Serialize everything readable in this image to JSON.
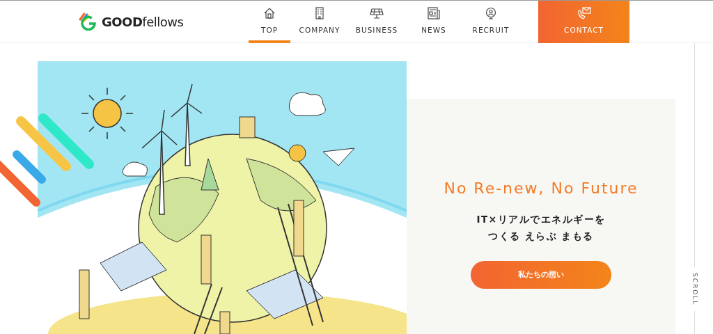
{
  "logo": {
    "text": "**GOOD**fellows"
  },
  "nav": [
    {
      "label": "TOP",
      "selected": true
    },
    {
      "label": "COMPANY",
      "selected": false
    },
    {
      "label": "BUSINESS",
      "selected": false
    },
    {
      "label": "NEWS",
      "selected": false
    },
    {
      "label": "RECRUIT",
      "selected": false
    }
  ],
  "contact": {
    "label": "CONTACT"
  },
  "hero": {
    "title": "No Re-new, No Future",
    "lines": [
      "IT×リアルでエネルギーを",
      "つくる えらぶ まもる"
    ],
    "button": "私たちの想い"
  },
  "scroll": {
    "label": "SCROLL"
  }
}
